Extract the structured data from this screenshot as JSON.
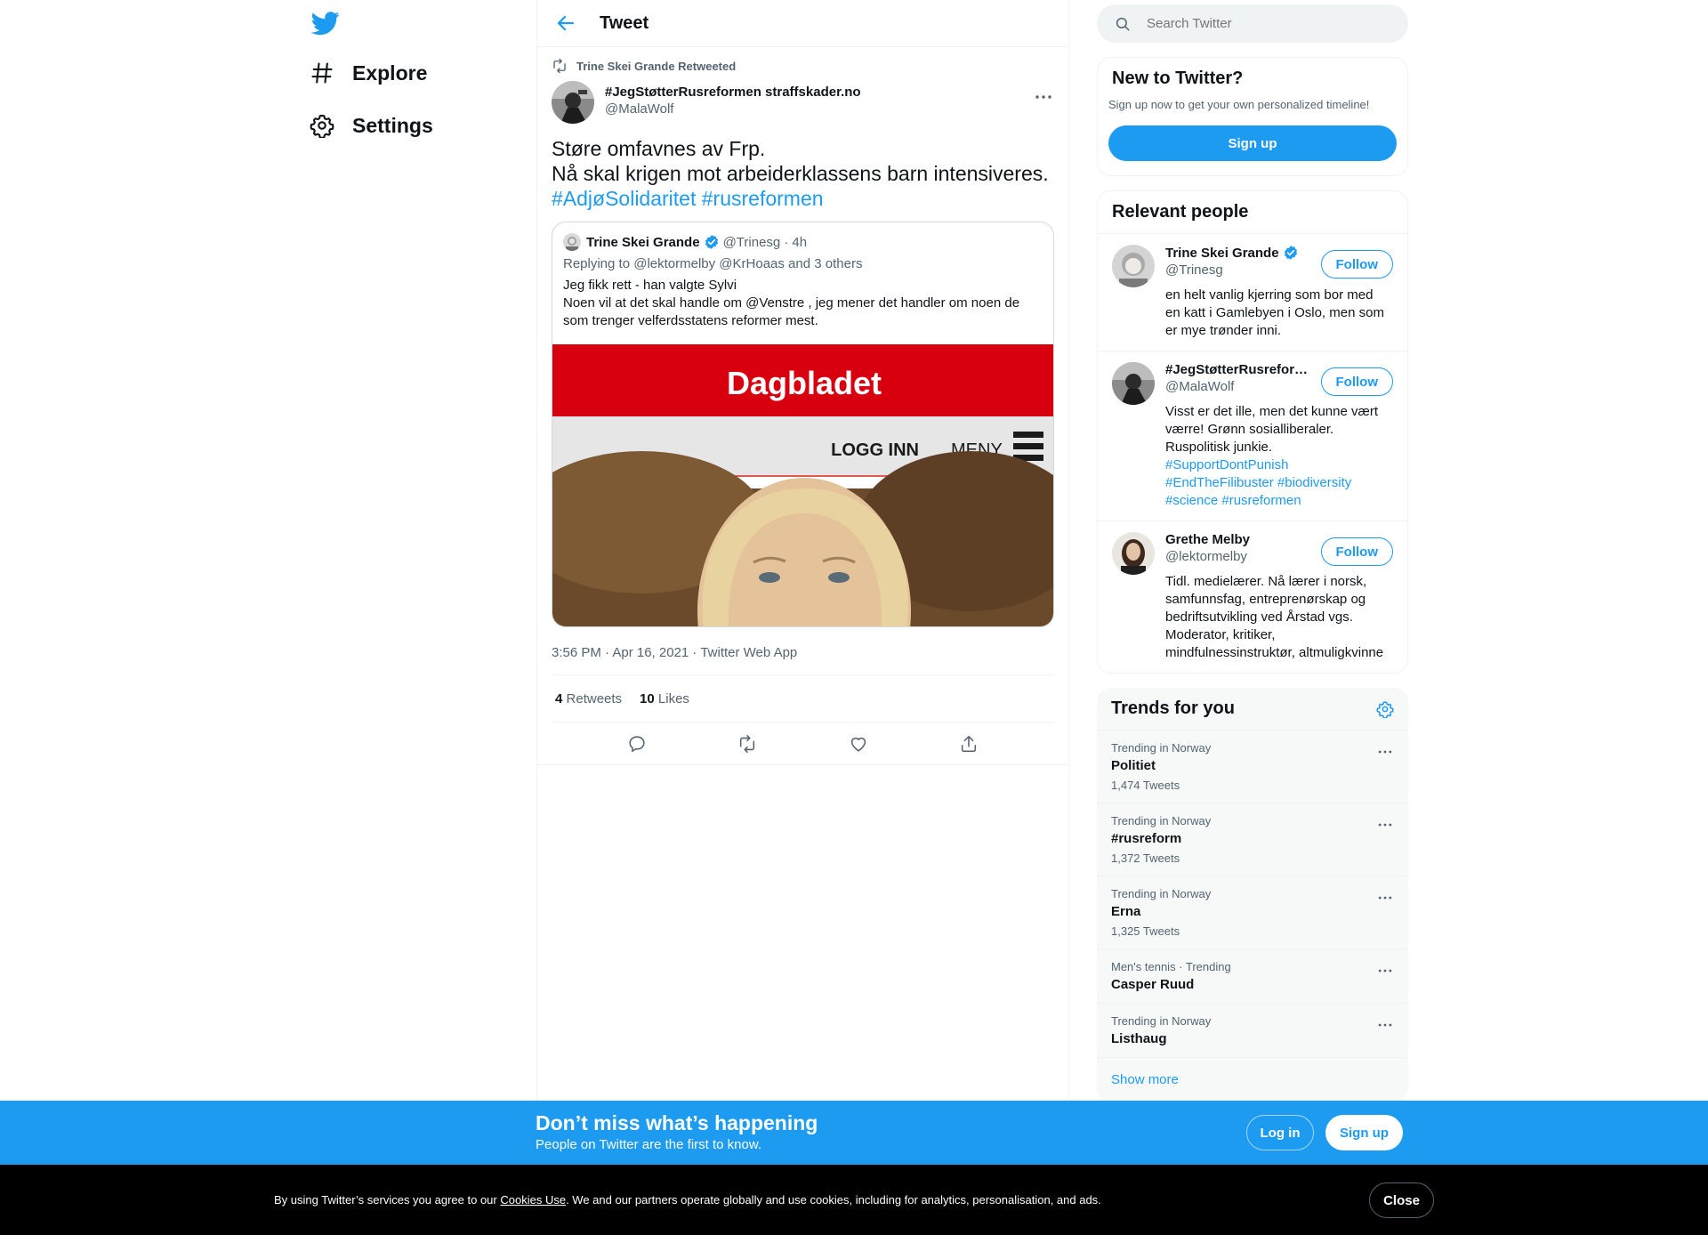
{
  "nav": {
    "items": [
      {
        "label": "Explore"
      },
      {
        "label": "Settings"
      }
    ]
  },
  "header": {
    "title": "Tweet"
  },
  "tweet": {
    "retweeted_by": "Trine Skei Grande Retweeted",
    "author_name": "#JegStøtterRusreformen straffskader.no",
    "author_handle": "@MalaWolf",
    "text_line1": "Støre omfavnes av Frp.",
    "text_line2": "Nå skal krigen mot arbeiderklassens barn intensiveres.",
    "hashtag1": "#AdjøSolidaritet",
    "hashtag2": "#rusreformen",
    "quote": {
      "name": "Trine Skei Grande",
      "handle": "@Trinesg",
      "time": "· 4h",
      "replying": "Replying to @lektormelby @KrHoaas and 3 others",
      "line1": "Jeg fikk rett - han valgte Sylvi",
      "line2": "Noen vil at det skal handle om @Venstre , jeg mener det handler om noen de som trenger velferdsstatens reformer mest.",
      "image": {
        "brand": "Dagbladet",
        "login": "LOGG INN",
        "menu": "MENY"
      }
    },
    "timestamp": "3:56 PM · Apr 16, 2021 · Twitter Web App",
    "retweets_count": "4",
    "retweets_label": "Retweets",
    "likes_count": "10",
    "likes_label": "Likes"
  },
  "search": {
    "placeholder": "Search Twitter"
  },
  "new_to_twitter": {
    "title": "New to Twitter?",
    "subtitle": "Sign up now to get your own personalized timeline!",
    "button": "Sign up"
  },
  "relevant": {
    "title": "Relevant people",
    "follow_label": "Follow",
    "people": [
      {
        "name": "Trine Skei Grande",
        "handle": "@Trinesg",
        "bio": "en helt vanlig kjerring som bor med en katt i Gamlebyen i Oslo, men som er mye trønder inni."
      },
      {
        "name": "#JegStøtterRusrefor…",
        "handle": "@MalaWolf",
        "bio": "Visst er det ille, men det kunne vært værre! Grønn sosialliberaler. Ruspolitisk junkie.",
        "tags": "#SupportDontPunish #EndTheFilibuster #biodiversity #science #rusreformen"
      },
      {
        "name": "Grethe Melby",
        "handle": "@lektormelby",
        "bio": "Tidl. medielærer. Nå lærer i norsk, samfunnsfag, entreprenørskap og bedriftsutvikling ved Årstad vgs. Moderator, kritiker, mindfulnessinstruktør, altmuligkvinne"
      }
    ]
  },
  "trends": {
    "title": "Trends for you",
    "items": [
      {
        "context": "Trending in Norway",
        "name": "Politiet",
        "count": "1,474 Tweets"
      },
      {
        "context": "Trending in Norway",
        "name": "#rusreform",
        "count": "1,372 Tweets"
      },
      {
        "context": "Trending in Norway",
        "name": "Erna",
        "count": "1,325 Tweets"
      },
      {
        "context": "Men's tennis · Trending",
        "name": "Casper Ruud"
      },
      {
        "context": "Trending in Norway",
        "name": "Listhaug"
      }
    ],
    "show_more": "Show more"
  },
  "banner": {
    "title": "Don’t miss what’s happening",
    "subtitle": "People on Twitter are the first to know.",
    "login": "Log in",
    "signup": "Sign up"
  },
  "cookie": {
    "text_before": "By using Twitter’s services you agree to our ",
    "link": "Cookies Use",
    "text_after": ". We and our partners operate globally and use cookies, including for analytics, personalisation, and ads.",
    "close": "Close"
  },
  "colors": {
    "accent": "#1d9bf0",
    "text": "#0f1419",
    "secondary": "#536471",
    "banner_bg": "#1d9bf0",
    "cookie_bg": "#000000",
    "dagbladet_red": "#d8000f"
  }
}
